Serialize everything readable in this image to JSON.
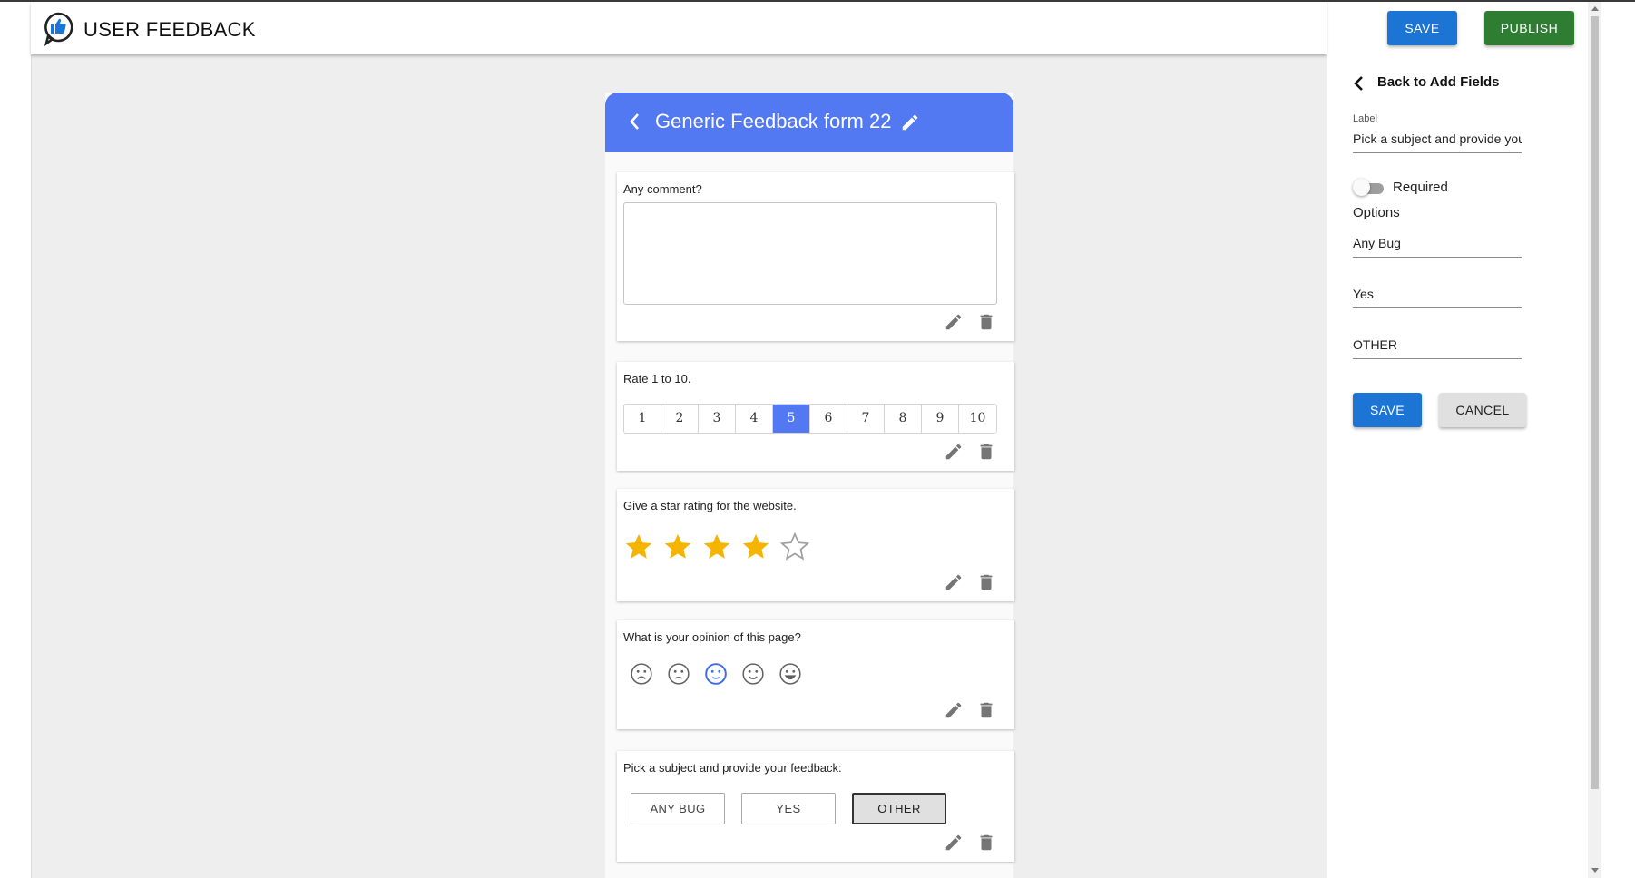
{
  "app": {
    "title": "USER FEEDBACK"
  },
  "toolbar": {
    "save_label": "SAVE",
    "publish_label": "PUBLISH",
    "save_color": "#1c74d4",
    "publish_color": "#2e7d32"
  },
  "form": {
    "title": "Generic Feedback form 22",
    "header_color": "#5379f2",
    "comment": {
      "question": "Any comment?",
      "value": ""
    },
    "rating": {
      "question": "Rate 1 to 10.",
      "options": [
        "1",
        "2",
        "3",
        "4",
        "5",
        "6",
        "7",
        "8",
        "9",
        "10"
      ],
      "selected": "5"
    },
    "stars": {
      "question": "Give a star rating for the website.",
      "value": 4,
      "max": 5,
      "color": "#f5b400"
    },
    "opinion": {
      "question": "What is your opinion of this page?",
      "faces": [
        "very-sad-face-icon",
        "sad-face-icon",
        "neutral-face-icon",
        "smile-face-icon",
        "grin-face-icon"
      ],
      "selected_index": 2
    },
    "subject": {
      "question": "Pick a subject and provide your feedback:",
      "options": [
        "ANY BUG",
        "YES",
        "OTHER"
      ],
      "selected": "OTHER"
    }
  },
  "editor": {
    "back_label": "Back to Add Fields",
    "label_caption": "Label",
    "label_value": "Pick a subject and provide your feedback:",
    "required_label": "Required",
    "required": false,
    "options_heading": "Options",
    "options": [
      "Any Bug",
      "Yes",
      "OTHER"
    ],
    "save_label": "SAVE",
    "cancel_label": "CANCEL"
  }
}
